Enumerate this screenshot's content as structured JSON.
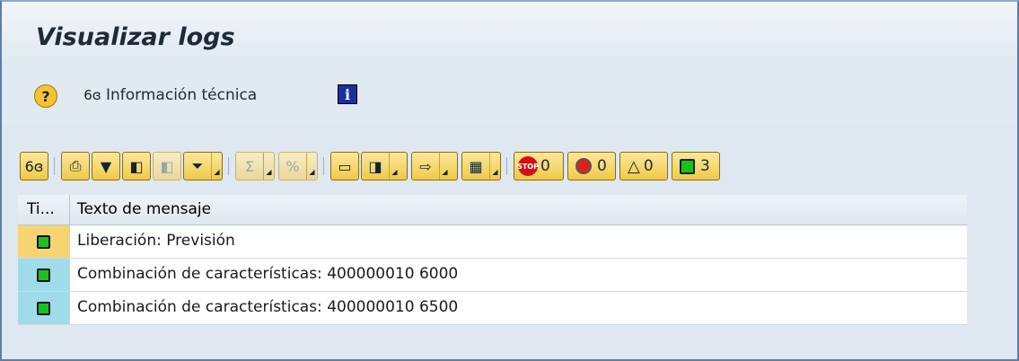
{
  "window": {
    "title": "Visualizar logs"
  },
  "appbar": {
    "tech_info_label": "Información técnica"
  },
  "toolbar": {
    "counts": {
      "stop": "0",
      "error": "0",
      "warning": "0",
      "ok": "3"
    },
    "icons": [
      "glasses-icon",
      "print-icon",
      "filter-icon",
      "find-icon",
      "find-next-icon",
      "set-filter-icon",
      "sum-icon",
      "subtotal-icon",
      "print-preview-icon",
      "details-icon",
      "export-icon",
      "layout-icon"
    ]
  },
  "table": {
    "columns": [
      "Ti...",
      "Texto de mensaje"
    ],
    "rows": [
      {
        "type": "ok",
        "text": "Liberación: Previsión"
      },
      {
        "type": "ok",
        "text": "Combinación de características: 400000010 6000"
      },
      {
        "type": "ok",
        "text": "Combinación de características: 400000010 6500"
      }
    ]
  },
  "colors": {
    "accent": "#f0c94a",
    "ok": "#18c21a",
    "selected": "#f7d472",
    "type_cell": "#9fdbe9"
  }
}
